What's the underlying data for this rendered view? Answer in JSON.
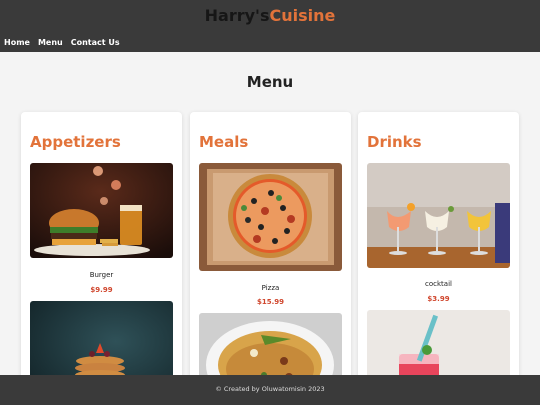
{
  "brand": {
    "part1": "Harry's",
    "part2": "Cuisine"
  },
  "nav": [
    "Home",
    "Menu",
    "Contact Us"
  ],
  "page_title": "Menu",
  "columns": [
    {
      "title": "Appetizers",
      "items": [
        {
          "name": "Burger",
          "price": "$9.99",
          "image": "burger-photo"
        },
        {
          "image": "pancakes-photo"
        }
      ]
    },
    {
      "title": "Meals",
      "items": [
        {
          "name": "Pizza",
          "price": "$15.99",
          "image": "pizza-photo"
        },
        {
          "image": "rice-photo"
        }
      ]
    },
    {
      "title": "Drinks",
      "items": [
        {
          "name": "cocktail",
          "price": "$3.99",
          "image": "cocktails-photo"
        },
        {
          "image": "red-drink-photo"
        }
      ]
    }
  ],
  "footer": "© Created by Oluwatomisin 2023",
  "colors": {
    "accent": "#e2733a",
    "price": "#d0462d",
    "header": "#3a3a3a"
  }
}
